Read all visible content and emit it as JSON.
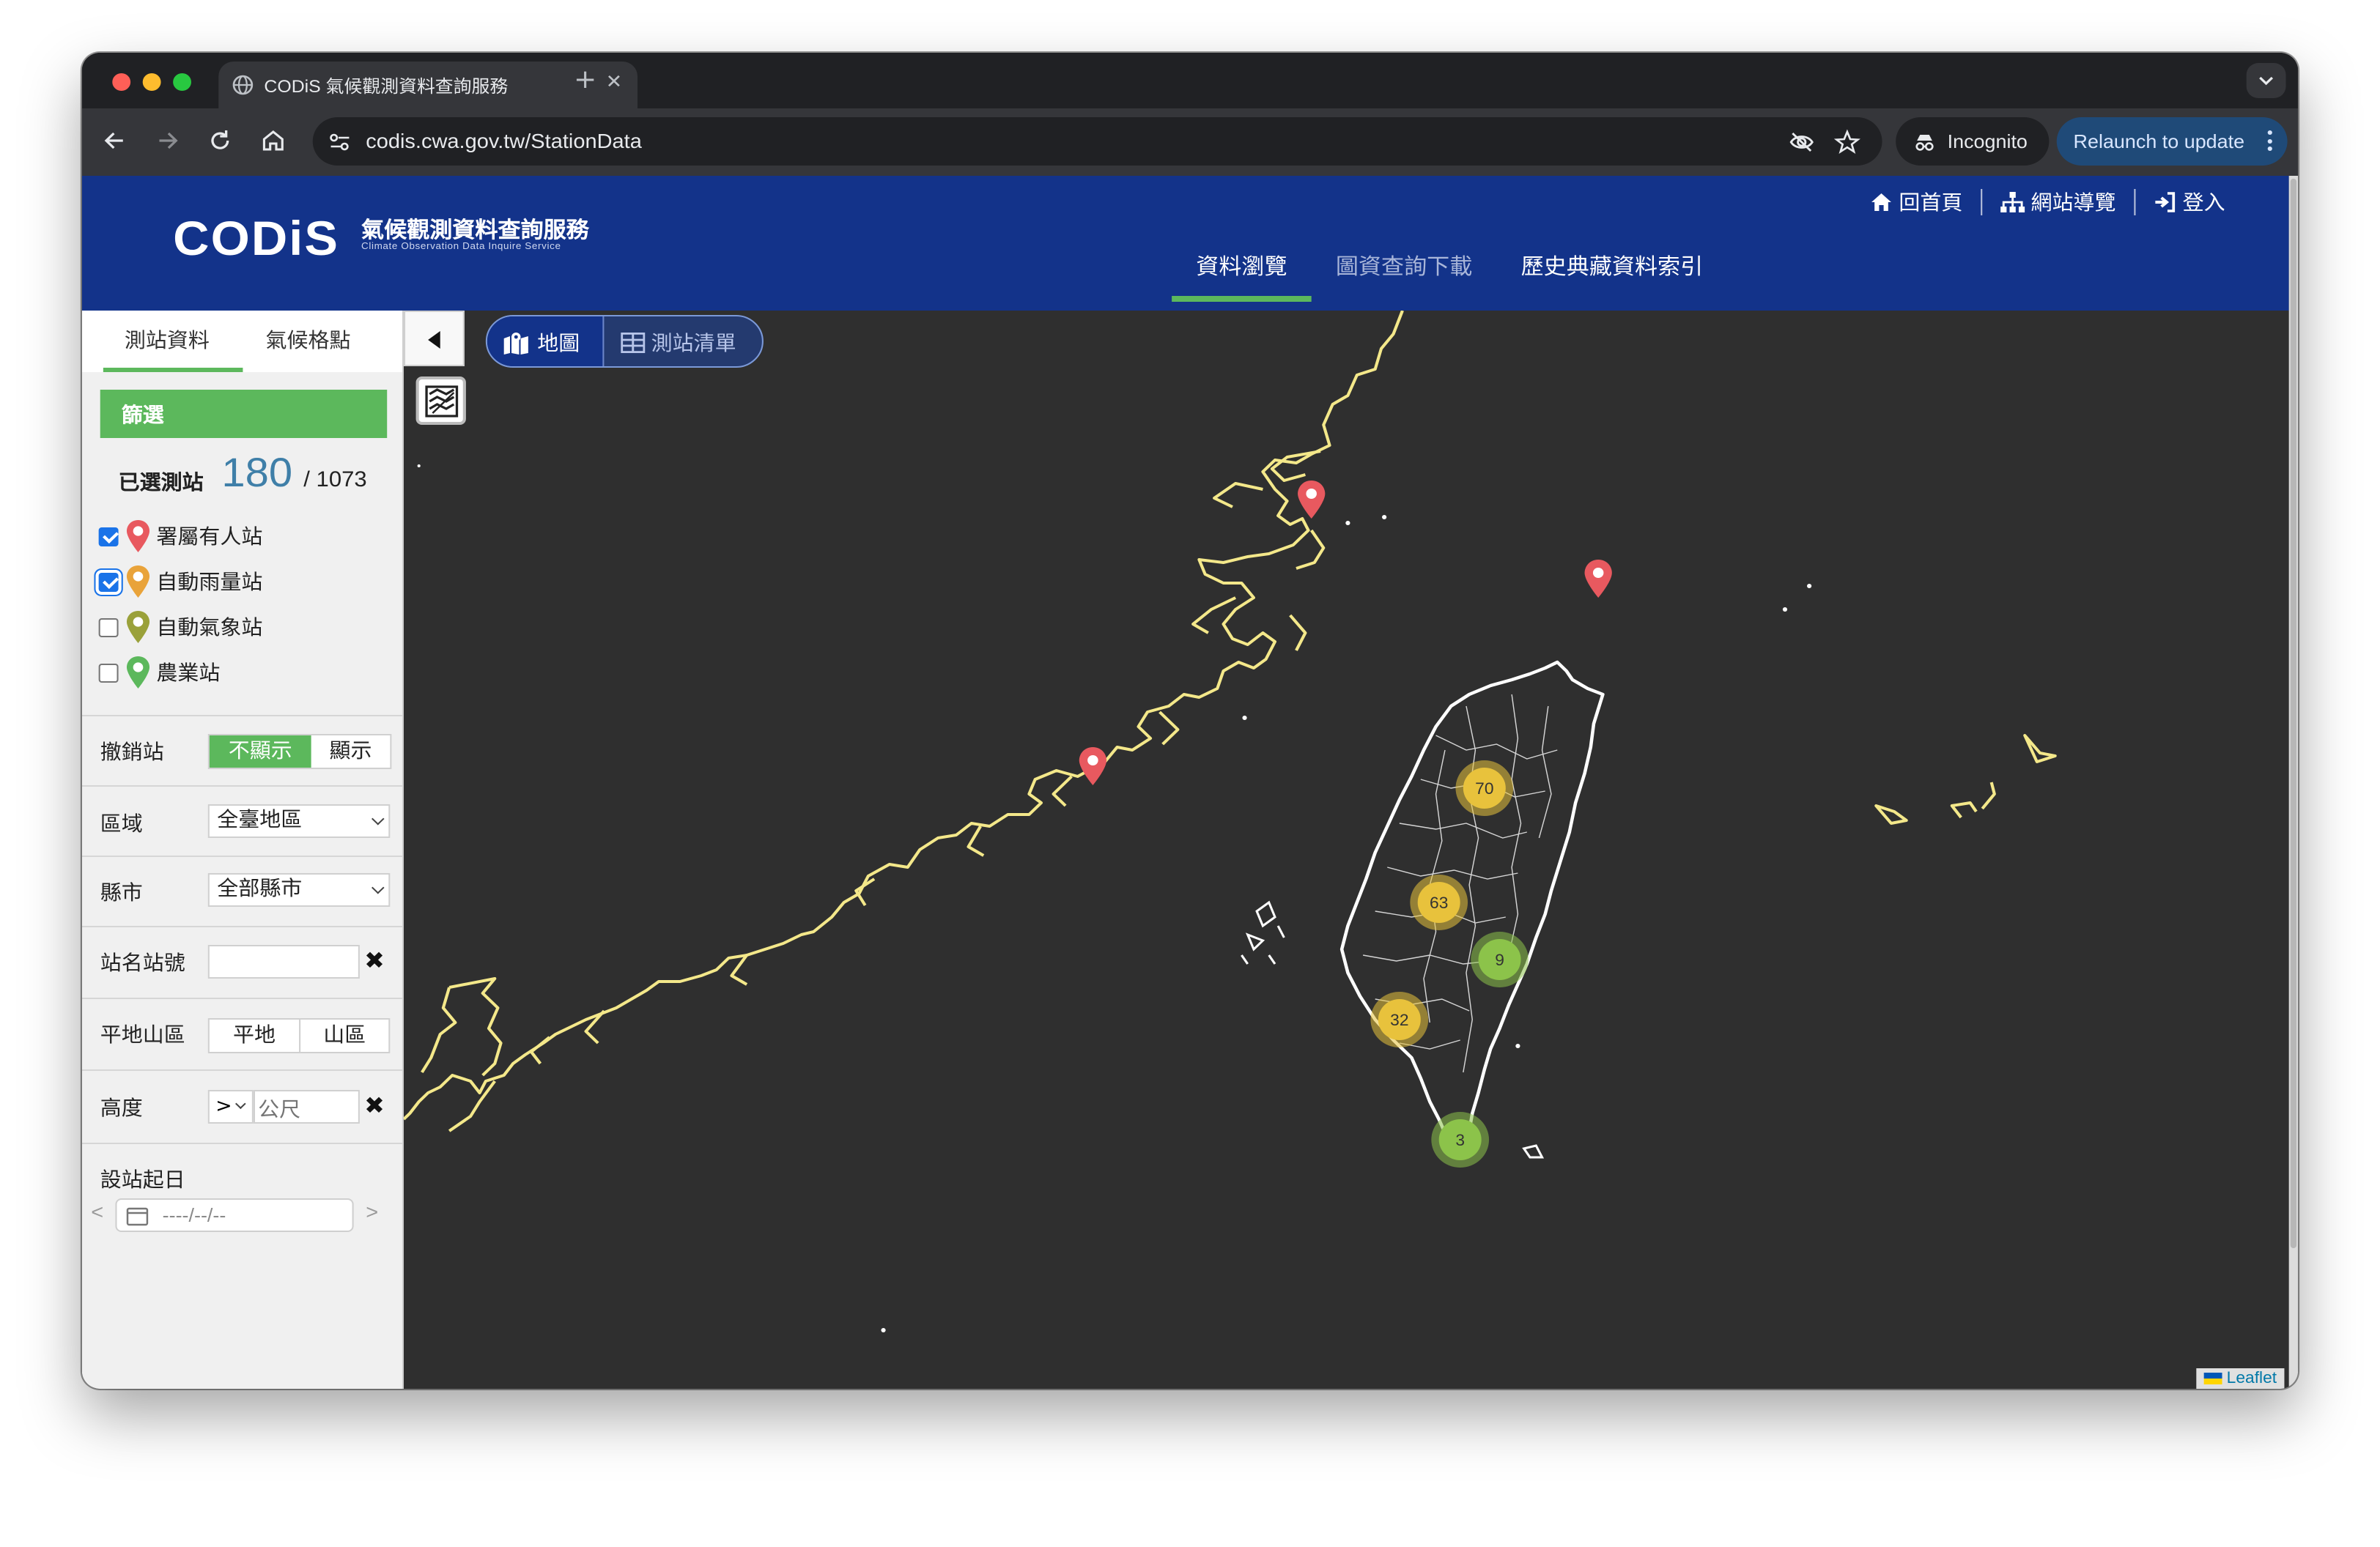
{
  "browser": {
    "tab_title": "CODiS 氣候觀測資料查詢服務",
    "url": "codis.cwa.gov.tw/StationData",
    "incognito_label": "Incognito",
    "relaunch_label": "Relaunch to update"
  },
  "header": {
    "logo_word": "CODiS",
    "logo_title": "氣候觀測資料查詢服務",
    "logo_subtitle": "Climate Observation Data Inquire Service",
    "top_links": [
      "回首頁",
      "網站導覽",
      "登入"
    ],
    "nav": [
      "資料瀏覽",
      "圖資查詢下載",
      "歷史典藏資料索引"
    ]
  },
  "sidebar": {
    "tabs": [
      "測站資料",
      "氣候格點"
    ],
    "filter_title": "篩選",
    "selected_label": "已選測站",
    "selected_count": "180",
    "selected_total": "/ 1073",
    "station_types": [
      {
        "label": "署屬有人站",
        "checked": true,
        "color": "#e8595f"
      },
      {
        "label": "自動雨量站",
        "checked": true,
        "color": "#e9a33a"
      },
      {
        "label": "自動氣象站",
        "checked": false,
        "color": "#9aa13a"
      },
      {
        "label": "農業站",
        "checked": false,
        "color": "#5cb85c"
      }
    ],
    "revoked_label": "撤銷站",
    "revoked_options": [
      "不顯示",
      "顯示"
    ],
    "region_label": "區域",
    "region_value": "全臺地區",
    "county_label": "縣市",
    "county_value": "全部縣市",
    "station_name_label": "站名站號",
    "terrain_label": "平地山區",
    "terrain_options": [
      "平地",
      "山區"
    ],
    "altitude_label": "高度",
    "altitude_operator": ">",
    "altitude_placeholder": "公尺",
    "start_date_label": "設站起日",
    "start_date_value": "----/--/--",
    "prev_arrow": "<",
    "next_arrow": ">"
  },
  "map": {
    "view_toggle": [
      "地圖",
      "測站清單"
    ],
    "attribution": "Leaflet",
    "clusters": [
      {
        "count": "70",
        "color": "#e8c23c"
      },
      {
        "count": "63",
        "color": "#e8c23c"
      },
      {
        "count": "9",
        "color": "#8cc34a"
      },
      {
        "count": "32",
        "color": "#e8c23c"
      },
      {
        "count": "3",
        "color": "#8cc34a"
      }
    ],
    "coastline_color": "#f4e88a",
    "marker_color": "#e8595f"
  }
}
